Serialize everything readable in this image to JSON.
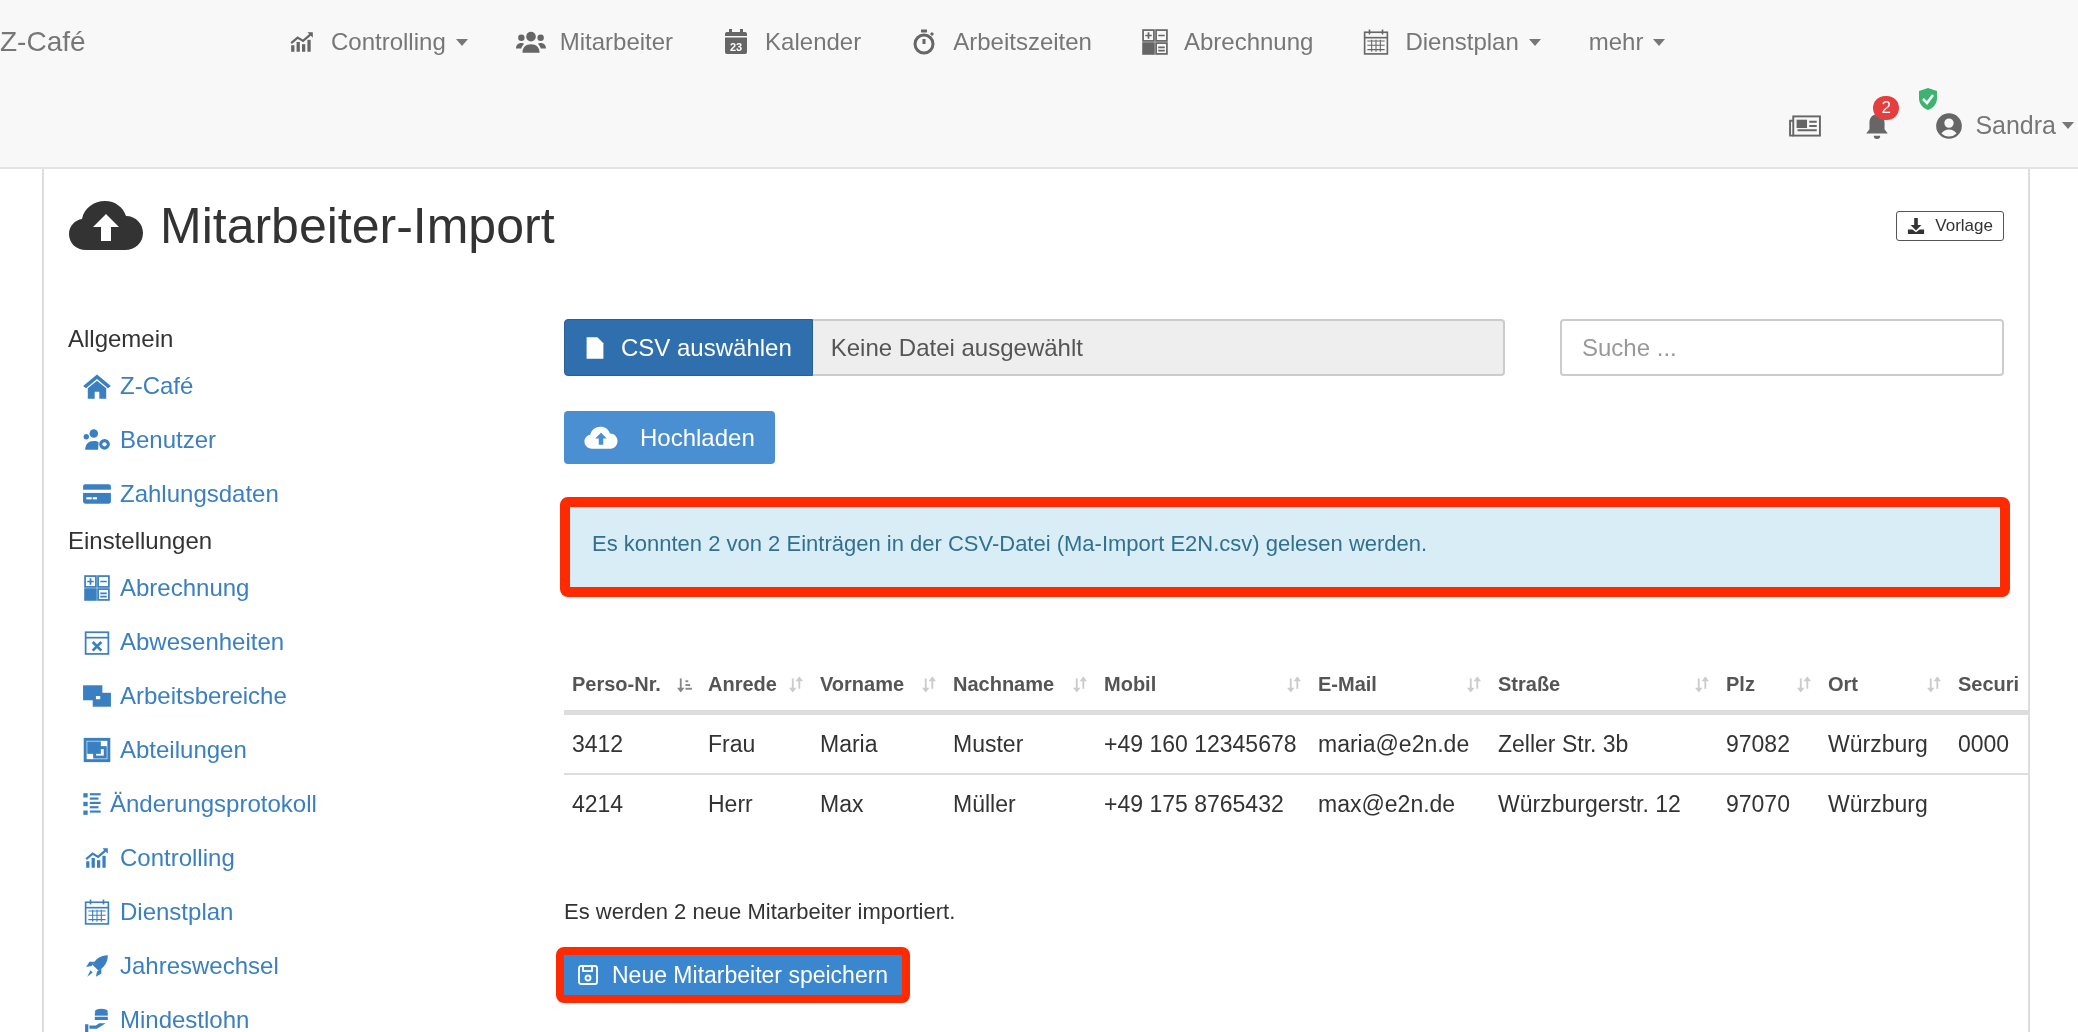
{
  "brand": "Z-Café",
  "nav": {
    "items": [
      {
        "label": "Controlling",
        "dropdown": true
      },
      {
        "label": "Mitarbeiter",
        "dropdown": false
      },
      {
        "label": "Kalender",
        "dropdown": false,
        "icon_text": "23"
      },
      {
        "label": "Arbeitszeiten",
        "dropdown": false
      },
      {
        "label": "Abrechnung",
        "dropdown": false
      },
      {
        "label": "Dienstplan",
        "dropdown": true
      },
      {
        "label": "mehr",
        "dropdown": true
      }
    ],
    "notification_count": "2",
    "user": {
      "name": "Sandra",
      "dropdown": true
    }
  },
  "title": "Mitarbeiter-Import",
  "template_button": "Vorlage",
  "sidebar": {
    "sections": [
      {
        "heading": "Allgemein",
        "items": [
          {
            "label": "Z-Café"
          },
          {
            "label": "Benutzer"
          },
          {
            "label": "Zahlungsdaten"
          }
        ]
      },
      {
        "heading": "Einstellungen",
        "items": [
          {
            "label": "Abrechnung"
          },
          {
            "label": "Abwesenheiten"
          },
          {
            "label": "Arbeitsbereiche"
          },
          {
            "label": "Abteilungen"
          },
          {
            "label": "Änderungsprotokoll"
          },
          {
            "label": "Controlling"
          },
          {
            "label": "Dienstplan"
          },
          {
            "label": "Jahreswechsel"
          },
          {
            "label": "Mindestlohn"
          }
        ]
      }
    ]
  },
  "file_picker": {
    "button": "CSV auswählen",
    "value": "Keine Datei ausgewählt"
  },
  "search": {
    "placeholder": "Suche ..."
  },
  "upload_button": "Hochladen",
  "alert": {
    "text": "Es konnten 2 von 2 Einträgen in der CSV-Datei (Ma-Import E2N.csv) gelesen werden.",
    "highlighted": true
  },
  "table": {
    "columns": [
      {
        "label": "Perso-Nr.",
        "sorted": true
      },
      {
        "label": "Anrede",
        "sorted": false
      },
      {
        "label": "Vorname",
        "sorted": false
      },
      {
        "label": "Nachname",
        "sorted": false
      },
      {
        "label": "Mobil",
        "sorted": false
      },
      {
        "label": "E-Mail",
        "sorted": false
      },
      {
        "label": "Straße",
        "sorted": false
      },
      {
        "label": "Plz",
        "sorted": false
      },
      {
        "label": "Ort",
        "sorted": false
      },
      {
        "label": "Securi"
      }
    ],
    "rows": [
      [
        "3412",
        "Frau",
        "Maria",
        "Muster",
        "+49 160 12345678",
        "maria@e2n.de",
        "Zeller Str. 3b",
        "97082",
        "Würzburg",
        "0000"
      ],
      [
        "4214",
        "Herr",
        "Max",
        "Müller",
        "+49 175 8765432",
        "max@e2n.de",
        "Würzburgerstr. 12",
        "97070",
        "Würzburg",
        ""
      ]
    ]
  },
  "summary": "Es werden 2 neue Mitarbeiter importiert.",
  "save_button": {
    "label": "Neue Mitarbeiter speichern",
    "highlighted": true
  }
}
